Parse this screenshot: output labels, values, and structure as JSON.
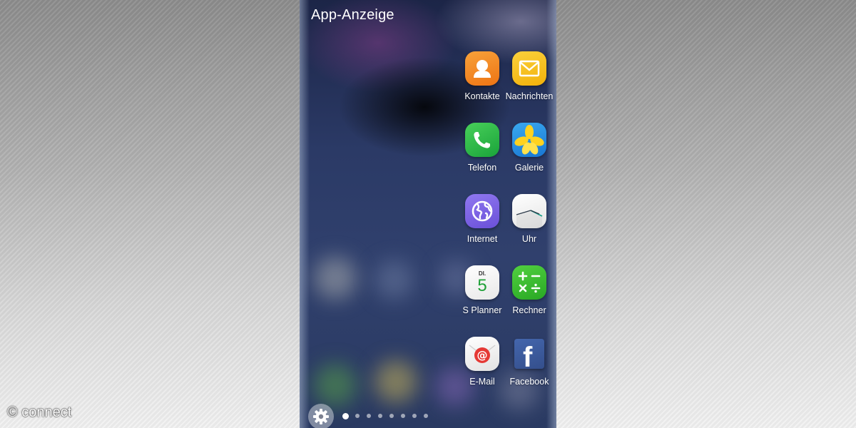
{
  "screen": {
    "title": "App-Anzeige"
  },
  "apps": [
    {
      "label": "Kontakte",
      "icon": "contacts-icon",
      "color": "#f2881e"
    },
    {
      "label": "Nachrichten",
      "icon": "messages-icon",
      "color": "#f7c520"
    },
    {
      "label": "Telefon",
      "icon": "phone-icon",
      "color": "#2dbb4a"
    },
    {
      "label": "Galerie",
      "icon": "gallery-icon",
      "color": "#1f8de0"
    },
    {
      "label": "Internet",
      "icon": "internet-icon",
      "color": "#8065e6"
    },
    {
      "label": "Uhr",
      "icon": "clock-icon",
      "color": "#f6f6f6"
    },
    {
      "label": "S Planner",
      "icon": "calendar-icon",
      "color": "#f7f7f7"
    },
    {
      "label": "Rechner",
      "icon": "calculator-icon",
      "color": "#3dbb2f"
    },
    {
      "label": "E-Mail",
      "icon": "email-icon",
      "color": "#efefef"
    },
    {
      "label": "Facebook",
      "icon": "facebook-icon",
      "color": "#3b5b98"
    }
  ],
  "planner_icon": {
    "day_abbrev": "DI.",
    "day_number": "5"
  },
  "facebook_icon": {
    "glyph": "f"
  },
  "pager": {
    "page_count": 8,
    "active_index": 0
  },
  "settings": {
    "icon": "gear-icon"
  },
  "watermark": {
    "text": "© connect"
  }
}
